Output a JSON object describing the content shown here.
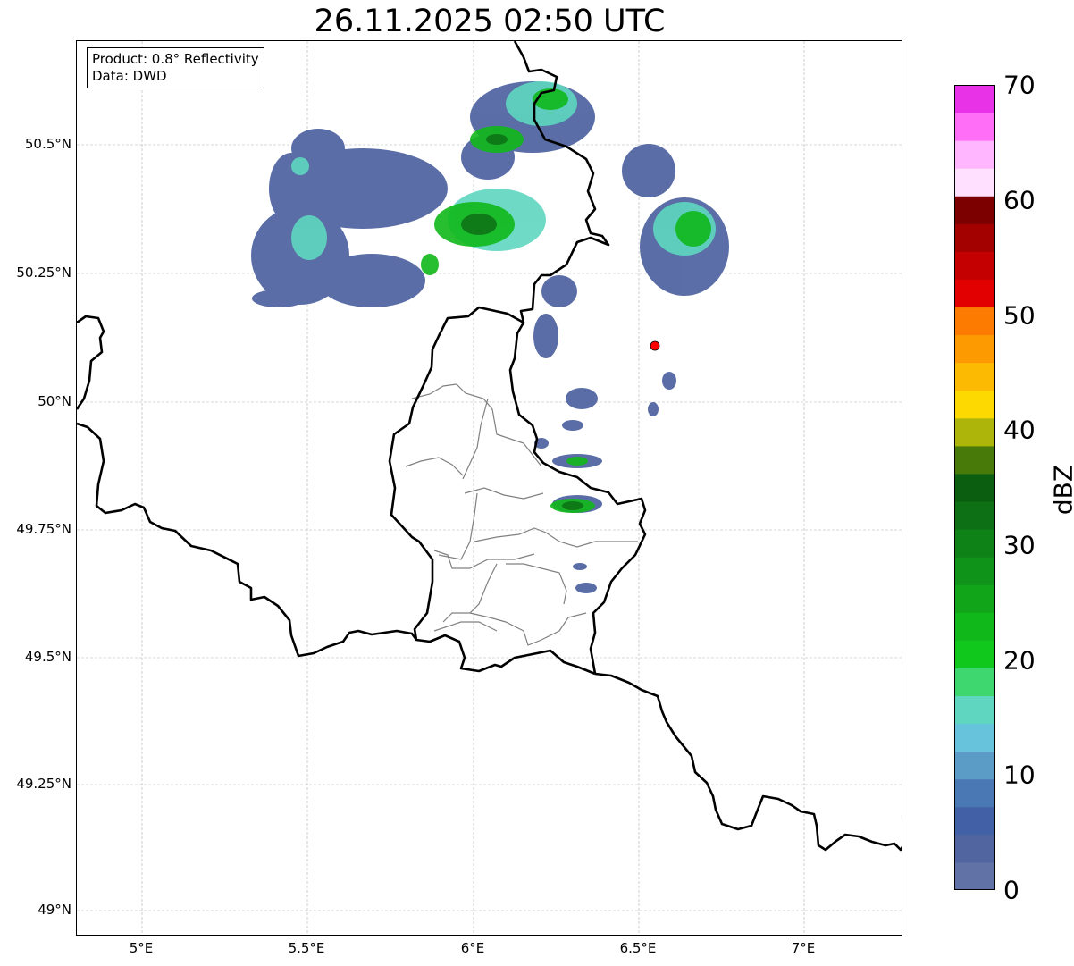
{
  "title": "26.11.2025 02:50 UTC",
  "info": {
    "product": "Product: 0.8° Reflectivity",
    "data": "Data: DWD"
  },
  "axes": {
    "x_ticks": [
      "5°E",
      "5.5°E",
      "6°E",
      "6.5°E",
      "7°E"
    ],
    "y_ticks": [
      "50.5°N",
      "50.25°N",
      "50°N",
      "49.75°N",
      "49.5°N",
      "49.25°N",
      "49°N"
    ]
  },
  "colorbar": {
    "label": "dBZ",
    "tick_labels": [
      "0",
      "10",
      "20",
      "30",
      "40",
      "50",
      "60",
      "70"
    ],
    "colors": [
      "#6173a6",
      "#5166a0",
      "#4260a6",
      "#4a78b4",
      "#5b9cc6",
      "#67c3dc",
      "#5fd7c0",
      "#3ed66e",
      "#10c81c",
      "#10b81a",
      "#11a619",
      "#0f9318",
      "#0e8117",
      "#0d7015",
      "#0b5d10",
      "#477a08",
      "#adb40a",
      "#fdd901",
      "#fdba02",
      "#fd9a02",
      "#fc7b00",
      "#e20000",
      "#c40000",
      "#a30000",
      "#7d0000",
      "#ffe0ff",
      "#ffb6ff",
      "#ff6ef7",
      "#e832e8"
    ]
  },
  "station_marker": {
    "label": "",
    "color": "#ff0000"
  }
}
